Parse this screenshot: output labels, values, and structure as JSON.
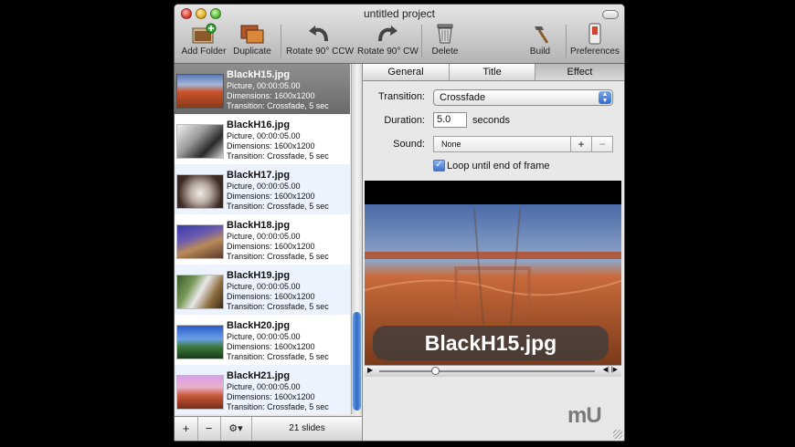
{
  "window": {
    "title": "untitled project"
  },
  "toolbar": {
    "add_folder": "Add Folder",
    "duplicate": "Duplicate",
    "rotate_ccw": "Rotate 90° CCW",
    "rotate_cw": "Rotate 90° CW",
    "delete": "Delete",
    "build": "Build",
    "preferences": "Preferences"
  },
  "slides": [
    {
      "name": "BlackH15.jpg",
      "type": "Picture, 00:00:05.00",
      "dims": "Dimensions: 1600x1200",
      "trans": "Transition: Crossfade, 5 sec"
    },
    {
      "name": "BlackH16.jpg",
      "type": "Picture, 00:00:05.00",
      "dims": "Dimensions: 1600x1200",
      "trans": "Transition: Crossfade, 5 sec"
    },
    {
      "name": "BlackH17.jpg",
      "type": "Picture, 00:00:05.00",
      "dims": "Dimensions: 1600x1200",
      "trans": "Transition: Crossfade, 5 sec"
    },
    {
      "name": "BlackH18.jpg",
      "type": "Picture, 00:00:05.00",
      "dims": "Dimensions: 1600x1200",
      "trans": "Transition: Crossfade, 5 sec"
    },
    {
      "name": "BlackH19.jpg",
      "type": "Picture, 00:00:05.00",
      "dims": "Dimensions: 1600x1200",
      "trans": "Transition: Crossfade, 5 sec"
    },
    {
      "name": "BlackH20.jpg",
      "type": "Picture, 00:00:05.00",
      "dims": "Dimensions: 1600x1200",
      "trans": "Transition: Crossfade, 5 sec"
    },
    {
      "name": "BlackH21.jpg",
      "type": "Picture, 00:00:05.00",
      "dims": "Dimensions: 1600x1200",
      "trans": "Transition: Crossfade, 5 sec"
    }
  ],
  "list_footer": {
    "add": "+",
    "remove": "−",
    "gear": "⚙▾",
    "count": "21 slides"
  },
  "tabs": [
    "General",
    "Title",
    "Effect"
  ],
  "effect": {
    "transition_label": "Transition:",
    "transition_value": "Crossfade",
    "duration_label": "Duration:",
    "duration_value": "5.0",
    "duration_unit": "seconds",
    "sound_label": "Sound:",
    "sound_value": "None",
    "sound_add": "+",
    "sound_remove": "−",
    "loop_label": "Loop until end of frame"
  },
  "preview": {
    "caption": "BlackH15.jpg"
  },
  "logo_text": "mU",
  "colors": {
    "selection": "#7d7d7d",
    "alt_row": "#edf3fe",
    "accent": "#3d73cc"
  }
}
